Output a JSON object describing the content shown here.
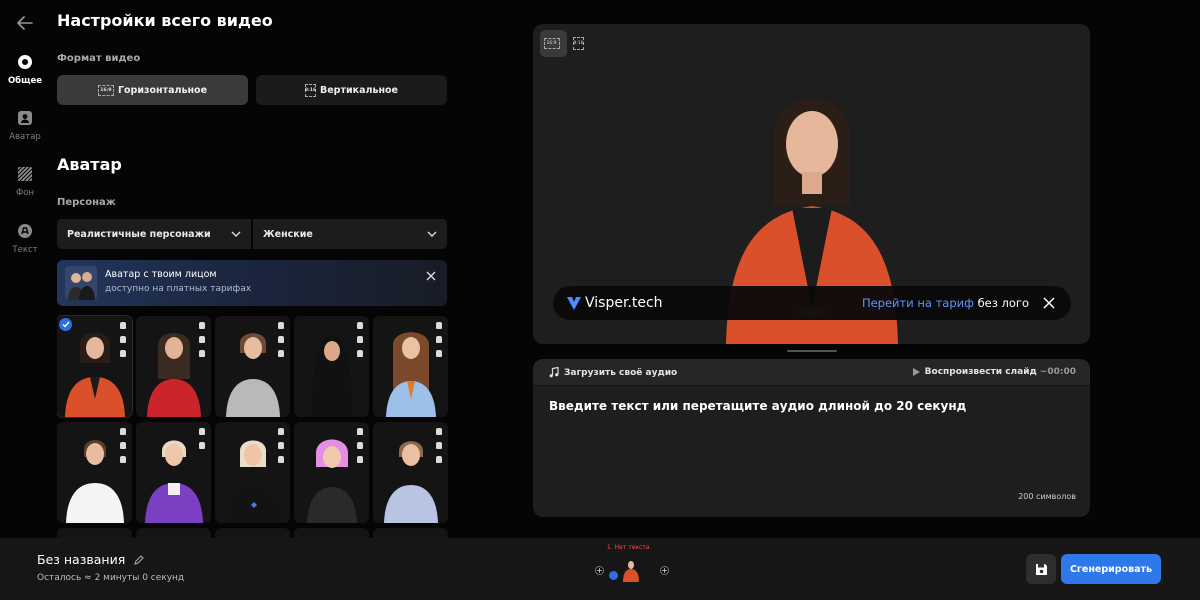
{
  "app": {
    "panel_title": "Настройки всего видео"
  },
  "rail": {
    "items": [
      {
        "label": "Общее",
        "icon": "settings-icon",
        "active": true
      },
      {
        "label": "Аватар",
        "icon": "avatar-icon",
        "active": false
      },
      {
        "label": "Фон",
        "icon": "background-icon",
        "active": false
      },
      {
        "label": "Текст",
        "icon": "text-icon",
        "active": false
      }
    ]
  },
  "format": {
    "label": "Формат видео",
    "horizontal_label": "Горизонтальное",
    "horizontal_ratio": "16:9",
    "vertical_label": "Вертикальное",
    "vertical_ratio": "9:16"
  },
  "avatar": {
    "title": "Аватар",
    "character_label": "Персонаж",
    "type_select": "Реалистичные персонажи",
    "gender_select": "Женские",
    "promo_title": "Аватар с твоим лицом",
    "promo_subtitle": "доступно на платных тарифах"
  },
  "preview": {
    "ratio_active": "16:9",
    "ratio_alt": "9:16",
    "banner_logo": "Visper.tech",
    "banner_link": "Перейти на тариф",
    "banner_suffix": " без лого"
  },
  "editor": {
    "upload_label": "Загрузить своё аудио",
    "play_label": "Воспроизвести слайд",
    "play_duration": "~00:00",
    "prompt": "Введите текст или перетащите аудио длиной до 20 секунд",
    "char_count": "200 символов"
  },
  "bottom": {
    "project_title": "Без названия",
    "remaining": "Осталось ≈ 2 минуты 0 секунд",
    "timeline_warning": "1. Нет текста",
    "plus": "+",
    "generate_label": "Сгенерировать"
  },
  "colors": {
    "accent": "#2f78ea",
    "link": "#5b95ff",
    "warning": "#ff4a4a",
    "jacket": "#d9502a"
  }
}
